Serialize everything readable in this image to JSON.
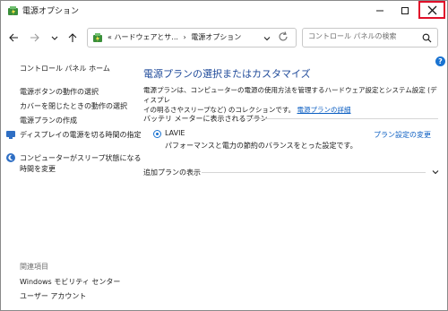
{
  "window": {
    "title": "電源オプション",
    "close_color": "#e0102a"
  },
  "address": {
    "prefix": "«",
    "path_parent": "ハードウェアとサ...",
    "path_separator": "›",
    "path_current": "電源オプション"
  },
  "search": {
    "placeholder": "コントロール パネルの検索"
  },
  "sidebar": {
    "home": "コントロール パネル ホーム",
    "items": [
      "電源ボタンの動作の選択",
      "カバーを閉じたときの動作の選択",
      "電源プランの作成",
      "ディスプレイの電源を切る時間の指定",
      "コンピューターがスリープ状態になる",
      "時間を変更"
    ],
    "related_heading": "関連項目",
    "related": [
      "Windows モビリティ センター",
      "ユーザー アカウント"
    ]
  },
  "main": {
    "title": "電源プランの選択またはカスタマイズ",
    "desc_line1": "電源プランは、コンピューターの電源の使用方法を管理するハードウェア設定とシステム設定 (ディスプレ",
    "desc_line2": "イの明るさやスリープなど) のコレクションです。",
    "desc_link": "電源プランの詳細",
    "battery_section": "バッテリ メーターに表示されるプラン",
    "plan_name": "LAVIE",
    "plan_desc": "パフォーマンスと電力の節約のバランスをとった設定です。",
    "change_link": "プラン設定の変更",
    "more_plans": "追加プランの表示"
  },
  "colors": {
    "accent": "#1a73d1",
    "link": "#0b5ec2",
    "heading": "#1f4a9a"
  }
}
